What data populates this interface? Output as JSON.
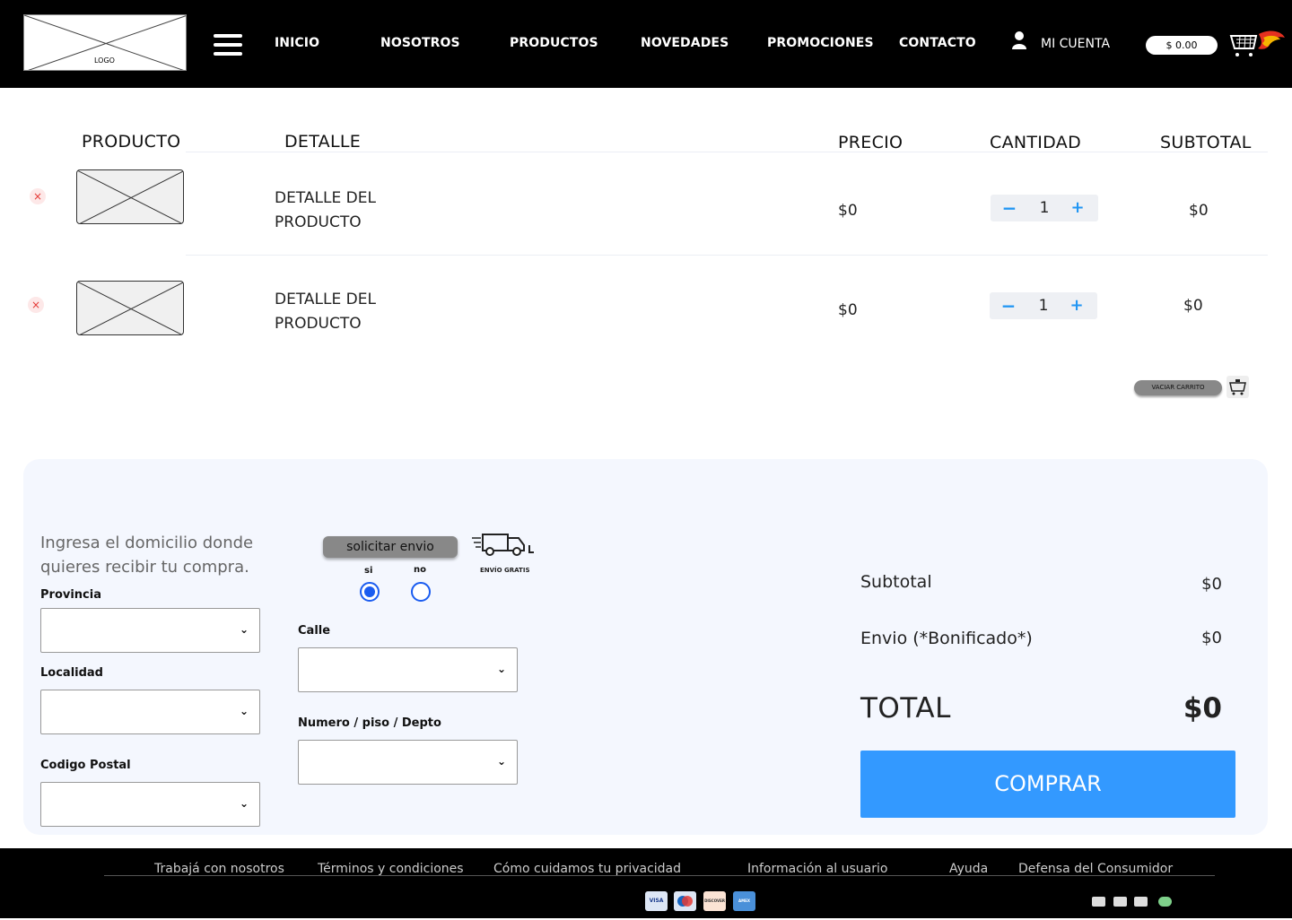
{
  "header": {
    "logo_label": "LOGO",
    "nav": [
      "INICIO",
      "NOSOTROS",
      "PRODUCTOS",
      "NOVEDADES",
      "PROMOCIONES",
      "CONTACTO"
    ],
    "account_label": "MI CUENTA",
    "cart_total": "$ 0.00"
  },
  "table": {
    "headers": {
      "product": "PRODUCTO",
      "detail": "DETALLE",
      "price": "PRECIO",
      "quantity": "CANTIDAD",
      "subtotal": "SUBTOTAL"
    },
    "rows": [
      {
        "remove": "×",
        "detail": "DETALLE DEL PRODUCTO",
        "price": "$0",
        "minus": "−",
        "qty": "1",
        "plus": "+",
        "subtotal": "$0"
      },
      {
        "remove": "×",
        "detail": "DETALLE DEL PRODUCTO",
        "price": "$0",
        "minus": "−",
        "qty": "1",
        "plus": "+",
        "subtotal": "$0"
      }
    ],
    "empty_cart_label": "VACIAR CARRITO"
  },
  "checkout": {
    "intro": "Ingresa el domicilio donde quieres recibir tu compra.",
    "labels": {
      "province": "Provincia",
      "city": "Localidad",
      "postal": "Codigo Postal",
      "street": "Calle",
      "number": "Numero / piso / Depto"
    },
    "chevron": "⌄",
    "shipping_button": "solicitar envio",
    "radio_yes": "si",
    "radio_no": "no",
    "radio_selected": "si",
    "free_shipping": "ENVÍO GRATIS"
  },
  "summary": {
    "subtotal_label": "Subtotal",
    "subtotal_value": "$0",
    "shipping_label": "Envio (*Bonificado*)",
    "shipping_value": "$0",
    "total_label": "TOTAL",
    "total_value": "$0",
    "buy_label": "COMPRAR"
  },
  "footer": {
    "links": [
      "Trabajá con nosotros",
      "Términos y condiciones",
      "Cómo cuidamos tu privacidad",
      "Información al usuario",
      "Ayuda",
      "Defensa del Consumidor"
    ],
    "payments": [
      "VISA",
      "",
      "DISCOVER",
      "AMEX"
    ]
  },
  "colors": {
    "accent": "#3399ff",
    "header_bg": "#000000",
    "panel_bg": "#f4f7fe",
    "radio": "#1a5cf0"
  },
  "icons": [
    "hamburger-menu-icon",
    "user-icon",
    "cart-icon",
    "close-icon",
    "minus-icon",
    "plus-icon",
    "empty-cart-icon",
    "truck-icon",
    "chevron-down-icon",
    "visa-icon",
    "maestro-icon",
    "discover-icon",
    "amex-icon",
    "instagram-icon",
    "facebook-icon",
    "twitter-icon",
    "whatsapp-icon"
  ]
}
